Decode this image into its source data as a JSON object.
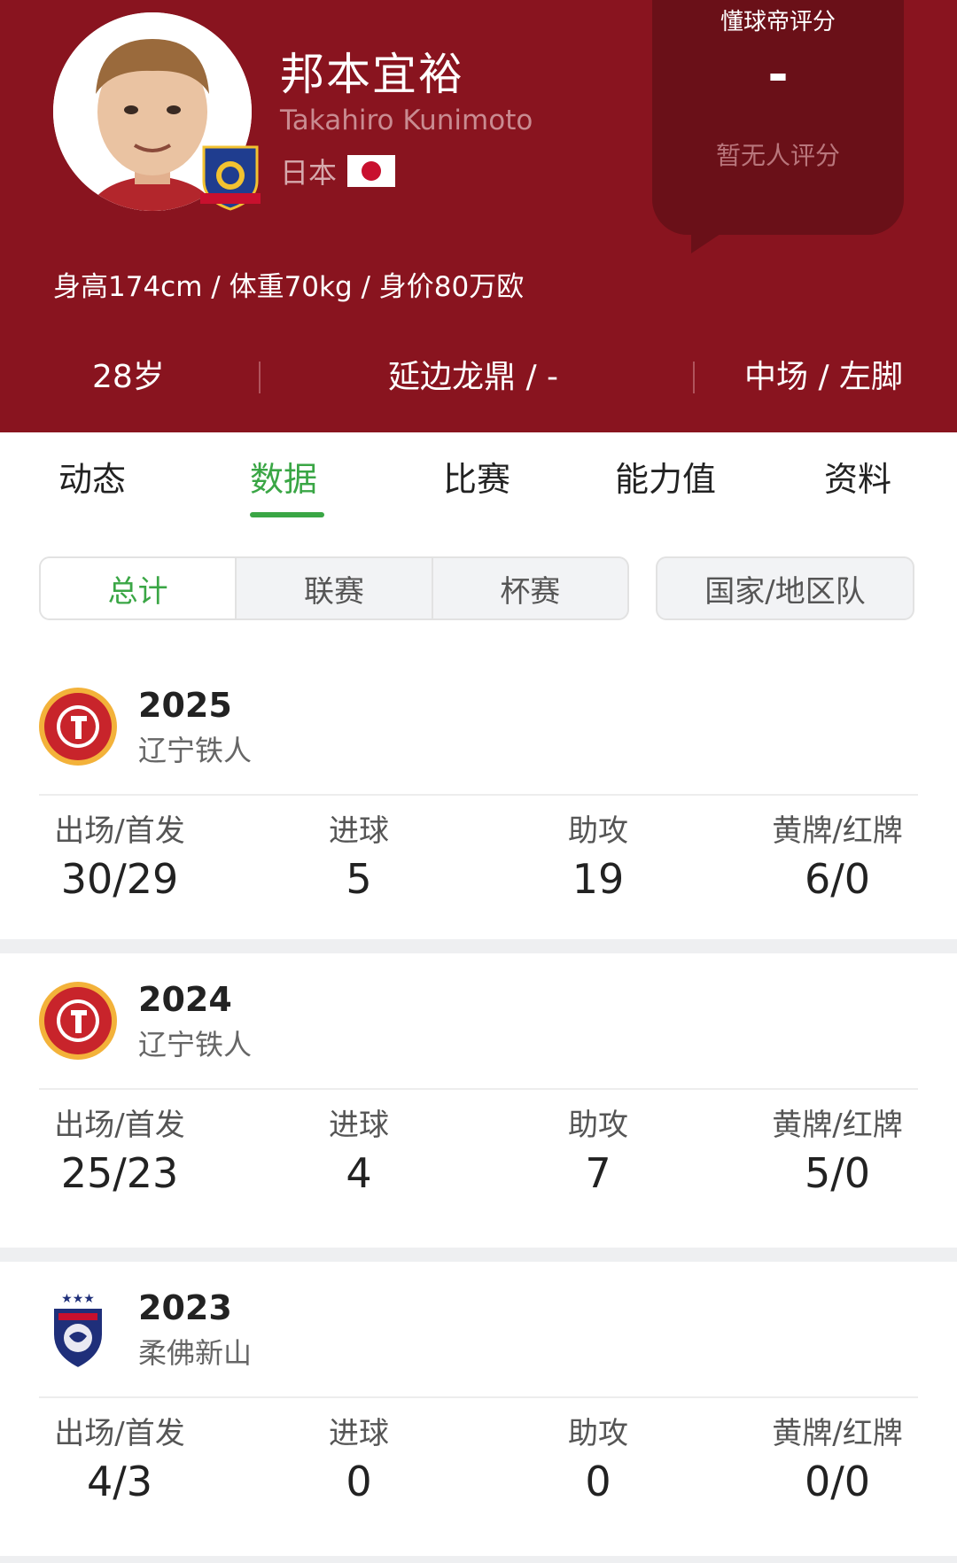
{
  "player": {
    "name": "邦本宜裕",
    "name_en": "Takahiro Kunimoto",
    "nation": "日本",
    "physical": "身高174cm / 体重70kg / 身价80万欧",
    "age": "28岁",
    "club": "延边龙鼎 / -",
    "position": "中场 / 左脚"
  },
  "rating": {
    "title": "懂球帝评分",
    "value": "-",
    "note": "暂无人评分"
  },
  "tabs": [
    {
      "label": "动态"
    },
    {
      "label": "数据"
    },
    {
      "label": "比赛"
    },
    {
      "label": "能力值"
    },
    {
      "label": "资料"
    }
  ],
  "filters": {
    "segments": [
      {
        "label": "总计"
      },
      {
        "label": "联赛"
      },
      {
        "label": "杯赛"
      }
    ],
    "national": "国家/地区队"
  },
  "stat_labels": {
    "apps": "出场/首发",
    "goals": "进球",
    "assists": "助攻",
    "cards": "黄牌/红牌"
  },
  "seasons": [
    {
      "year": "2025",
      "club": "辽宁铁人",
      "apps": "30/29",
      "goals": "5",
      "assists": "19",
      "cards": "6/0"
    },
    {
      "year": "2024",
      "club": "辽宁铁人",
      "apps": "25/23",
      "goals": "4",
      "assists": "7",
      "cards": "5/0"
    },
    {
      "year": "2023",
      "club": "柔佛新山",
      "apps": "4/3",
      "goals": "0",
      "assists": "0",
      "cards": "0/0"
    }
  ],
  "colors": {
    "header": "#89141f",
    "accent": "#3aa645"
  }
}
